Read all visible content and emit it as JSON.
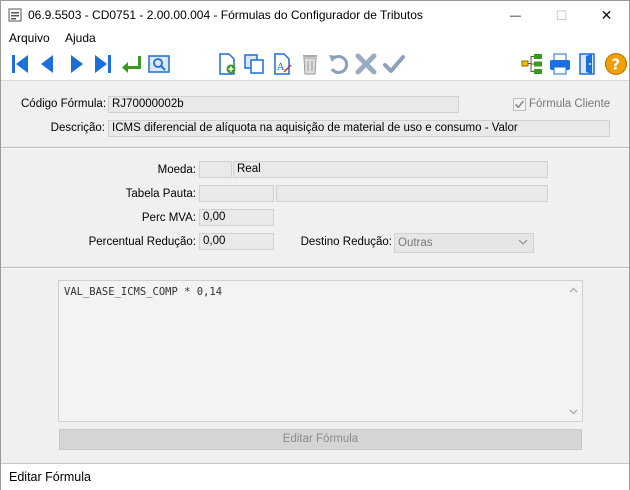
{
  "window": {
    "title": "06.9.5503 - CD0751 - 2.00.00.004 - Fórmulas do Configurador de Tributos",
    "controls": {
      "minimize": "—",
      "maximize": "☐",
      "close": "✕"
    }
  },
  "menu": {
    "items": [
      {
        "label": "Arquivo"
      },
      {
        "label": "Ajuda"
      }
    ]
  },
  "toolbar": {
    "icons": [
      "first-record-icon",
      "previous-record-icon",
      "next-record-icon",
      "last-record-icon",
      "return-icon",
      "search-icon",
      "new-document-icon",
      "copy-icon",
      "edit-text-icon",
      "delete-icon",
      "undo-icon",
      "cancel-icon",
      "confirm-icon",
      "hierarchy-icon",
      "print-icon",
      "exit-icon",
      "help-icon"
    ]
  },
  "header": {
    "codigo_label": "Código Fórmula:",
    "codigo_value": "RJ70000002b",
    "formula_cliente_label": "Fórmula Cliente",
    "formula_cliente_checked": true,
    "descricao_label": "Descrição:",
    "descricao_value": "ICMS diferencial de alíquota na aquisição de material de uso e consumo - Valor"
  },
  "params": {
    "moeda_label": "Moeda:",
    "moeda_code": "",
    "moeda_value": "Real",
    "tabela_pauta_label": "Tabela Pauta:",
    "tabela_pauta_code": "",
    "tabela_pauta_desc": "",
    "perc_mva_label": "Perc MVA:",
    "perc_mva_value": "0,00",
    "percentual_reducao_label": "Percentual Redução:",
    "percentual_reducao_value": "0,00",
    "destino_reducao_label": "Destino Redução:",
    "destino_reducao_value": "Outras"
  },
  "formula": {
    "text": "VAL_BASE_ICMS_COMP * 0,14",
    "edit_button": "Editar Fórmula"
  },
  "status": {
    "text": "Editar Fórmula"
  },
  "colors": {
    "accent_blue": "#1a6fd8",
    "green_arrow": "#3a9a1e",
    "help_orange": "#f0a000"
  }
}
